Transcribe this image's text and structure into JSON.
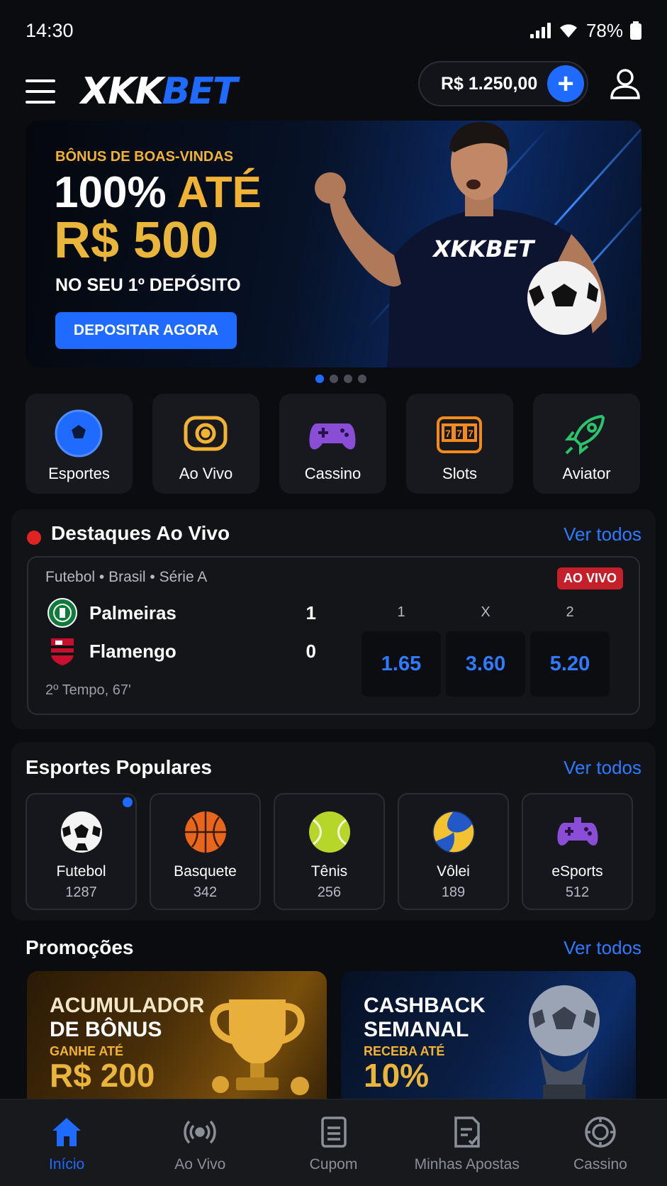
{
  "status_bar": {
    "time": "14:30",
    "battery": "78%"
  },
  "header": {
    "logo_part1": "XKK",
    "logo_part2": "BET",
    "balance": "R$ 1.250,00",
    "plus_label": "+"
  },
  "banner": {
    "kicker": "BÔNUS DE BOAS-VINDAS",
    "headline_a": "100%",
    "headline_b": "ATÉ",
    "amount": "R$ 500",
    "subline": "NO SEU 1º DEPÓSITO",
    "cta": "DEPOSITAR AGORA",
    "shirt_logo": "XKKBET",
    "carousel": {
      "total": 4,
      "active": 1
    }
  },
  "categories": [
    {
      "label": "Esportes",
      "icon": "soccer-ball-icon"
    },
    {
      "label": "Ao Vivo",
      "icon": "live-broadcast-icon"
    },
    {
      "label": "Cassino",
      "icon": "gamepad-icon"
    },
    {
      "label": "Slots",
      "icon": "slot-machine-icon"
    },
    {
      "label": "Aviator",
      "icon": "rocket-icon"
    }
  ],
  "live": {
    "title": "Destaques Ao Vivo",
    "see_all": "Ver todos",
    "match": {
      "league": "Futebol • Brasil • Série A",
      "badge": "AO VIVO",
      "home": {
        "name": "Palmeiras",
        "score": "1"
      },
      "away": {
        "name": "Flamengo",
        "score": "0"
      },
      "period": "2º Tempo, 67'",
      "odds": [
        {
          "label": "1",
          "value": "1.65"
        },
        {
          "label": "X",
          "value": "3.60"
        },
        {
          "label": "2",
          "value": "5.20"
        }
      ]
    }
  },
  "popular": {
    "title": "Esportes Populares",
    "see_all": "Ver todos",
    "sports": [
      {
        "name": "Futebol",
        "count": "1287",
        "icon": "soccer-ball-icon"
      },
      {
        "name": "Basquete",
        "count": "342",
        "icon": "basketball-icon"
      },
      {
        "name": "Tênis",
        "count": "256",
        "icon": "tennis-ball-icon"
      },
      {
        "name": "Vôlei",
        "count": "189",
        "icon": "volleyball-icon"
      },
      {
        "name": "eSports",
        "count": "512",
        "icon": "gamepad-icon"
      }
    ]
  },
  "promos": {
    "title": "Promoções",
    "see_all": "Ver todos",
    "items": [
      {
        "title_1": "ACUMULADOR",
        "title_2": "DE BÔNUS",
        "sub": "GANHE ATÉ",
        "value": "R$ 200",
        "icon": "trophy-icon"
      },
      {
        "title_1": "CASHBACK",
        "title_2": "SEMANAL",
        "sub": "RECEBA ATÉ",
        "value": "10%",
        "icon": "ball-trophy-icon"
      }
    ]
  },
  "bottom_nav": [
    {
      "label": "Início",
      "icon": "home-icon",
      "active": true
    },
    {
      "label": "Ao Vivo",
      "icon": "live-broadcast-icon",
      "active": false
    },
    {
      "label": "Cupom",
      "icon": "coupon-icon",
      "active": false
    },
    {
      "label": "Minhas Apostas",
      "icon": "bets-list-icon",
      "active": false
    },
    {
      "label": "Cassino",
      "icon": "casino-chip-icon",
      "active": false
    }
  ],
  "colors": {
    "accent": "#1f6bff",
    "gold": "#e9b53a",
    "live_red": "#e02424",
    "background": "#0b0c0f"
  }
}
